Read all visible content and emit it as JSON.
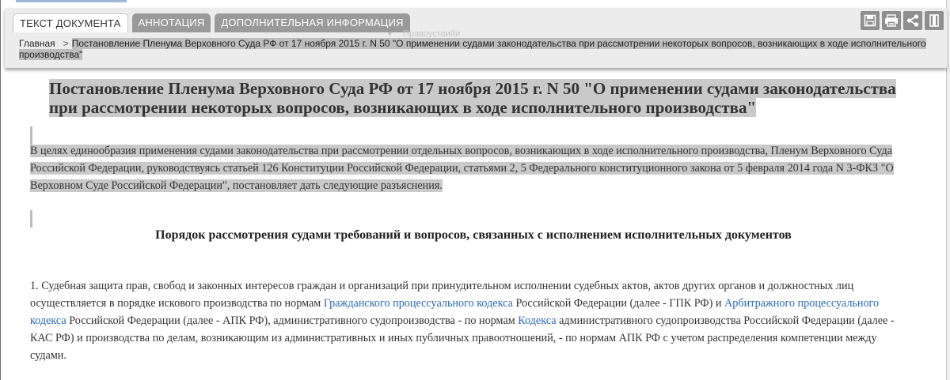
{
  "tabs": [
    {
      "label": "ТЕКСТ ДОКУМЕНТА",
      "active": true
    },
    {
      "label": "АННОТАЦИЯ",
      "active": false
    },
    {
      "label": "ДОПОЛНИТЕЛЬНАЯ ИНФОРМАЦИЯ",
      "active": false
    }
  ],
  "ghost_label": "Правоустоийи",
  "toolbar": [
    {
      "name": "save-icon"
    },
    {
      "name": "print-icon"
    },
    {
      "name": "share-icon"
    },
    {
      "name": "bookmark-icon"
    }
  ],
  "breadcrumb": {
    "home": "Главная",
    "separator": ">",
    "current": "Постановление Пленума Верховного Суда РФ от 17 ноября 2015 г. N 50 \"О применении судами законодательства при рассмотрении некоторых вопросов, возникающих в ходе исполнительного производства\""
  },
  "document": {
    "title": "Постановление Пленума Верховного Суда РФ от 17 ноября 2015 г. N 50 \"О применении судами законодательства при рассмотрении некоторых вопросов, возникающих в ходе исполнительного производства\"",
    "preamble": "В целях единообразия применения судами законодательства при рассмотрении отдельных вопросов, возникающих в ходе исполнительного производства, Пленум Верховного Суда Российской Федерации, руководствуясь статьей 126 Конституции Российской Федерации, статьями 2, 5 Федерального конституционного закона от 5 февраля 2014 года N 3-ФКЗ \"О Верховном Суде Российской Федерации\", постановляет дать следующие разъяснения.",
    "section_title": "Порядок рассмотрения судами требований и вопросов, связанных с исполнением исполнительных документов",
    "p1": {
      "t1": "1. Судебная защита прав, свобод и законных интересов граждан и организаций при принудительном исполнении судебных актов, актов других органов и должностных лиц осуществляется в порядке искового производства по нормам ",
      "link1": "Гражданского процессуального кодекса",
      "t2": " Российской Федерации (далее - ГПК РФ) и ",
      "link2": "Арбитражного процессуального кодекса",
      "t3": " Российской Федерации (далее - АПК РФ), административного судопроизводства - по нормам ",
      "link3": "Кодекса",
      "t4": " административного судопроизводства Российской Федерации (далее - КАС РФ) и производства по делам, возникающим из административных и иных публичных правоотношений, - по нормам АПК РФ с учетом распределения компетенции между судами."
    }
  }
}
